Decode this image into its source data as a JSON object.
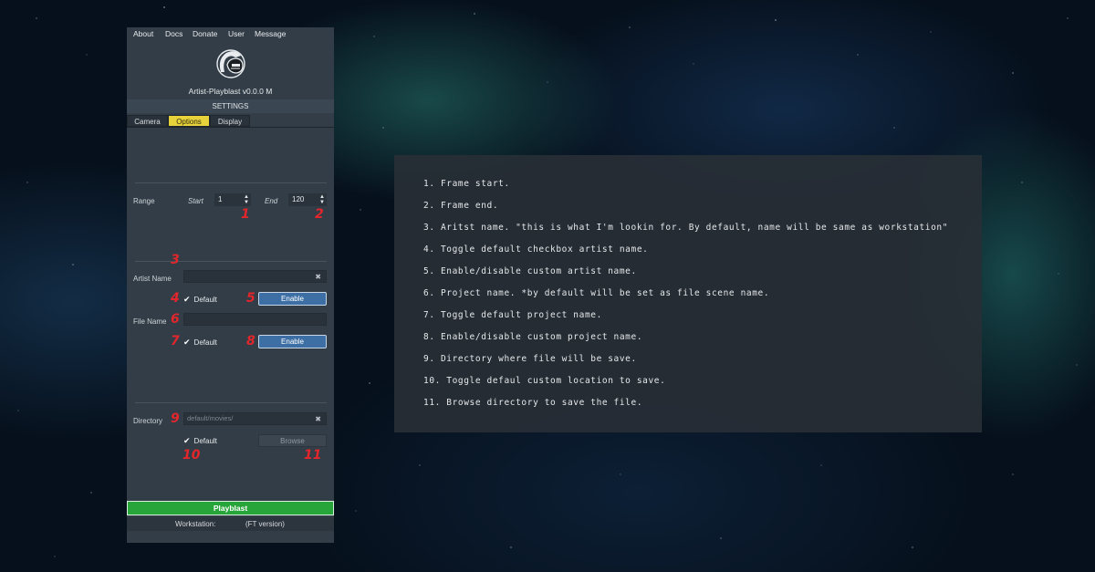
{
  "menu": [
    "About",
    "Docs",
    "Donate",
    "User",
    "Message"
  ],
  "app": {
    "title": "Artist-Playblast v0.0.0 M",
    "section": "SETTINGS"
  },
  "tabs": [
    {
      "label": "Camera",
      "active": false
    },
    {
      "label": "Options",
      "active": true
    },
    {
      "label": "Display",
      "active": false
    }
  ],
  "range": {
    "label": "Range",
    "start_label": "Start",
    "start_value": "1",
    "end_label": "End",
    "end_value": "120"
  },
  "artist": {
    "label": "Artist Name",
    "value": "",
    "default_label": "Default",
    "default_checked": true,
    "enable_label": "Enable"
  },
  "file": {
    "label": "File Name",
    "value": "",
    "default_label": "Default",
    "default_checked": true,
    "enable_label": "Enable"
  },
  "directory": {
    "label": "Directory",
    "placeholder": "default/movies/",
    "default_label": "Default",
    "default_checked": true,
    "browse_label": "Browse"
  },
  "markers": [
    "1",
    "2",
    "3",
    "4",
    "5",
    "6",
    "7",
    "8",
    "9",
    "10",
    "11"
  ],
  "playblast_label": "Playblast",
  "status": {
    "workstation_label": "Workstation:",
    "version": "(FT version)"
  },
  "notes": [
    "1. Frame start.",
    "2. Frame end.",
    "3. Aritst name. \"this is what I'm lookin for. By default, name will be same as workstation\"",
    "4. Toggle default checkbox artist name.",
    "5. Enable/disable custom artist name.",
    "6. Project name. *by default will be set as file scene name.",
    "7. Toggle default project name.",
    "8. Enable/disable custom project name.",
    "9. Directory where file will be save.",
    "10. Toggle defaul custom location to save.",
    "11. Browse directory to save the file."
  ],
  "colors": {
    "accent_tab": "#e8d23c",
    "enable_button": "#3d6fa5",
    "playblast_button": "#27a53b",
    "marker": "#e3262b",
    "panel": "#323d47"
  },
  "icons": {
    "logo": "spartan-helmet-icon",
    "clear": "clear-icon",
    "check": "checkmark-icon",
    "spin": "spin-arrows-icon"
  }
}
